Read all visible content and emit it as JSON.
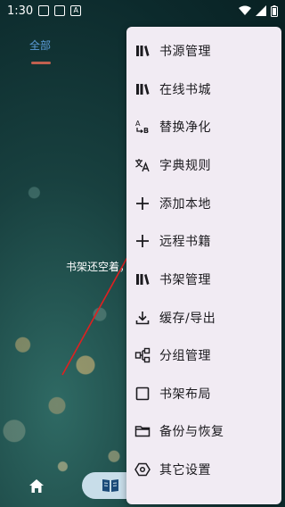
{
  "status_bar": {
    "time": "1:30"
  },
  "tabs": [
    {
      "label": "全部",
      "selected": true
    }
  ],
  "empty_state": {
    "message": "书架还空着，"
  },
  "menu": {
    "items": [
      {
        "label": "书源管理",
        "icon": "bookshelf-icon"
      },
      {
        "label": "在线书城",
        "icon": "bookshelf-icon"
      },
      {
        "label": "替换净化",
        "icon": "replace-icon"
      },
      {
        "label": "字典规则",
        "icon": "translate-icon"
      },
      {
        "label": "添加本地",
        "icon": "plus-icon"
      },
      {
        "label": "远程书籍",
        "icon": "plus-icon"
      },
      {
        "label": "书架管理",
        "icon": "bookshelf-icon"
      },
      {
        "label": "缓存/导出",
        "icon": "download-icon"
      },
      {
        "label": "分组管理",
        "icon": "group-icon"
      },
      {
        "label": "书架布局",
        "icon": "layout-square-icon"
      },
      {
        "label": "备份与恢复",
        "icon": "folder-icon"
      },
      {
        "label": "其它设置",
        "icon": "settings-hexagon-icon"
      }
    ]
  },
  "bottom_nav": {
    "items": [
      {
        "icon": "home-icon",
        "selected": false
      },
      {
        "icon": "book-icon",
        "selected": true
      }
    ]
  },
  "colors": {
    "menu_background": "#f1ebf3",
    "tab_active": "#5b9bd8",
    "tab_indicator": "#c0604f",
    "annotation_arrow": "#e02020",
    "nav_selected_pill": "#c8dde9"
  }
}
